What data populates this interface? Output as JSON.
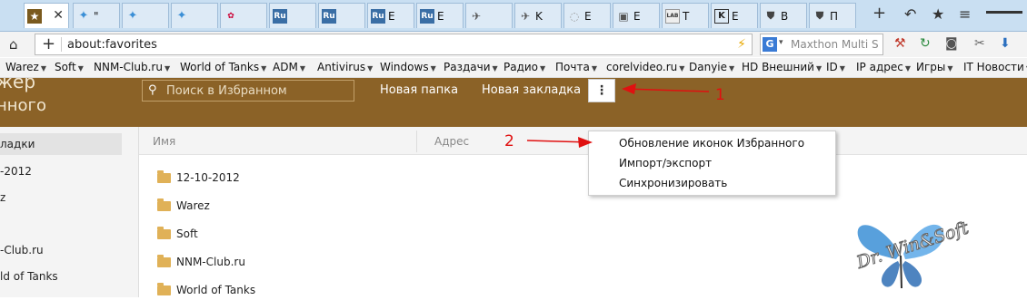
{
  "tabs": [
    {
      "icon": "star-icon",
      "title": "",
      "active": true
    },
    {
      "icon": "butterfly-icon",
      "title": "\""
    },
    {
      "icon": "butterfly-icon",
      "title": ""
    },
    {
      "icon": "butterfly-icon",
      "title": ""
    },
    {
      "icon": "colorful-icon",
      "title": ""
    },
    {
      "icon": "ru-icon",
      "title": ""
    },
    {
      "icon": "ru-icon",
      "title": ""
    },
    {
      "icon": "ru-icon",
      "title": "E"
    },
    {
      "icon": "ru-icon",
      "title": "E"
    },
    {
      "icon": "stamp-icon",
      "title": ""
    },
    {
      "icon": "stamp-icon",
      "title": "K"
    },
    {
      "icon": "gray-icon",
      "title": "E"
    },
    {
      "icon": "photo-icon",
      "title": "E"
    },
    {
      "icon": "lab-icon",
      "title": "T"
    },
    {
      "icon": "k-icon",
      "title": "E"
    },
    {
      "icon": "tank-icon",
      "title": "B"
    },
    {
      "icon": "tank-icon",
      "title": "П"
    }
  ],
  "tab_close": "✕",
  "toolbar_icons": [
    "+",
    "↶",
    "★",
    "≡"
  ],
  "address": {
    "url": "about:favorites"
  },
  "search": {
    "placeholder": "Maxthon Multi S",
    "engine": "G"
  },
  "bookmarks": [
    "Warez",
    "Soft",
    "NNM-Club.ru",
    "World of Tanks",
    "ADM",
    "Antivirus",
    "Windows",
    "Раздачи",
    "Радио",
    "Почта",
    "corelvideo.ru",
    "Danyie",
    "HD Внешний",
    "ID",
    "IP адрес",
    "Игры",
    "IT Новости"
  ],
  "header": {
    "title_line1": "жер",
    "title_line2": "нного",
    "search_placeholder": "Поиск в Избранном",
    "new_folder": "Новая папка",
    "new_bookmark": "Новая закладка",
    "kebab": "⋮"
  },
  "sidebar": {
    "items": [
      "ладки",
      "-2012",
      "z",
      "-Club.ru",
      "ld of Tanks"
    ]
  },
  "columns": {
    "name": "Имя",
    "address": "Адрес"
  },
  "folders": [
    "12-10-2012",
    "Warez",
    "Soft",
    "NNM-Club.ru",
    "World of Tanks"
  ],
  "menu": {
    "items": [
      "Обновление иконок Избранного",
      "Импорт/экспорт",
      "Синхронизировать"
    ]
  },
  "annotations": {
    "label1": "1",
    "label2": "2",
    "color": "#e01010"
  },
  "watermark": {
    "text": "Dr. Win&Soft"
  },
  "colors": {
    "header_bg": "#8b6227",
    "tabbar_bg": "#c9dff2"
  }
}
